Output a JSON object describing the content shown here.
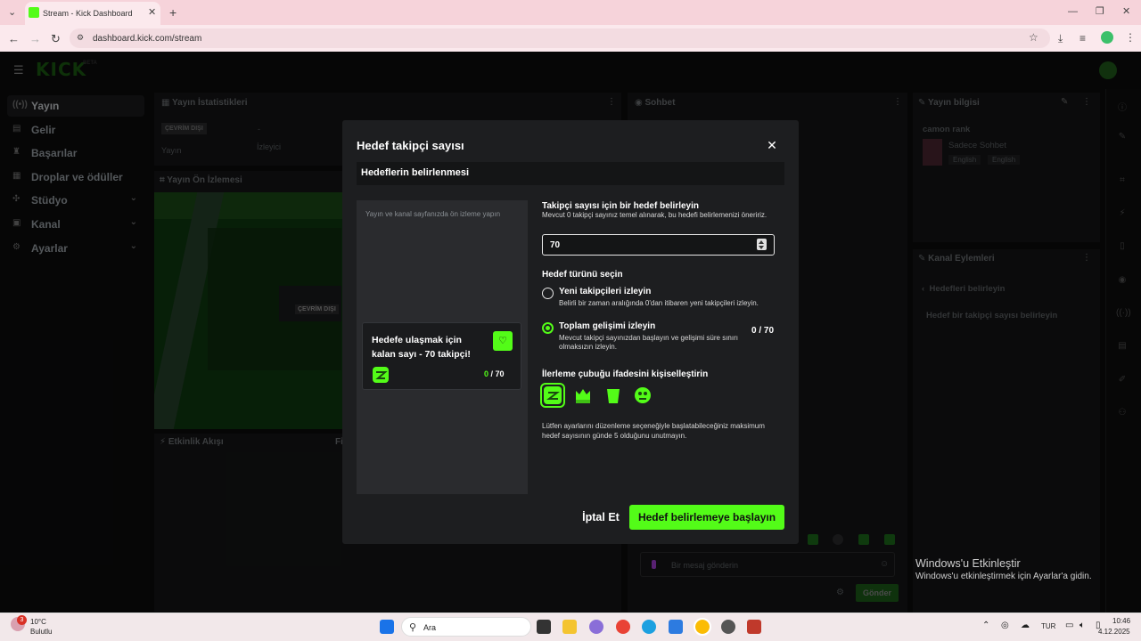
{
  "browser": {
    "tab_title": "Stream - Kick Dashboard",
    "url": "dashboard.kick.com/stream"
  },
  "app": {
    "logo": "KICK",
    "logo_badge": "BETA"
  },
  "sidebar": {
    "items": [
      {
        "label": "Yayın",
        "icon": "broadcast-icon",
        "active": true
      },
      {
        "label": "Gelir",
        "icon": "money-icon"
      },
      {
        "label": "Başarılar",
        "icon": "trophy-icon"
      },
      {
        "label": "Droplar ve ödüller",
        "icon": "gift-icon"
      },
      {
        "label": "Stüdyo",
        "icon": "studio-icon",
        "expandable": true
      },
      {
        "label": "Kanal",
        "icon": "channel-icon",
        "expandable": true
      },
      {
        "label": "Ayarlar",
        "icon": "gear-icon",
        "expandable": true
      }
    ]
  },
  "panels": {
    "stats_title": "Yayın İstatistikleri",
    "offline_badge": "ÇEVRİM DIŞI",
    "stats_dash": "-",
    "stats_col1": "Yayın",
    "stats_col2": "İzleyici",
    "preview_title": "Yayın Ön İzlemesi",
    "preview_offline": "ÇEVRİM DIŞI",
    "activity_title": "Etkinlik Akışı",
    "activity_filter": "Fi",
    "chat_title": "Sohbet",
    "chat_placeholder": "Bir mesaj gönderin",
    "chat_send": "Gönder",
    "info_title": "Yayın bilgisi",
    "info_stream_title": "camon rank",
    "info_category": "Sadece Sohbet",
    "info_tag1": "English",
    "info_tag2": "English",
    "actions_title": "Kanal Eylemleri",
    "actions_back": "Hedefleri belirleyin",
    "actions_item": "Hedef bir takipçi sayısı belirleyin"
  },
  "modal": {
    "title": "Hedef takipçi sayısı",
    "section_title": "Hedeflerin belirlenmesi",
    "preview_hint": "Yayın ve kanal sayfanızda ön izleme yapın",
    "card_title": "Hedefe ulaşmak için kalan sayı - 70 takipçi!",
    "card_count_current": "0",
    "card_count_total": "/ 70",
    "goal_label": "Takipçi sayısı için bir hedef belirleyin",
    "goal_hint": "Mevcut 0 takipçi sayınız temel alınarak, bu hedefi belirlemenizi öneririz.",
    "goal_value": "70",
    "type_label": "Hedef türünü seçin",
    "option1_title": "Yeni takipçileri izleyin",
    "option1_desc": "Belirli bir zaman aralığında 0'dan itibaren yeni takipçileri izleyin.",
    "option2_title": "Toplam gelişimi izleyin",
    "option2_desc": "Mevcut takipçi sayınızdan başlayın ve gelişimi süre sınırı olmaksızın izleyin.",
    "option2_count": "0 / 70",
    "selected_option": 2,
    "emote_label": "İlerleme çubuğu ifadesini kişiselleştirin",
    "emotes": [
      "kick-face-emote",
      "crown-emote",
      "green-blob-emote",
      "dizzy-emote"
    ],
    "note": "Lütfen ayarlarını düzenleme seçeneğiyle başlatabileceğiniz maksimum hedef sayısının günde 5 olduğunu unutmayın.",
    "cancel_label": "İptal Et",
    "start_label": "Hedef belirlemeye başlayın"
  },
  "taskbar": {
    "weather_temp": "10°C",
    "weather_desc": "Bulutlu",
    "notif_count": "3",
    "search_placeholder": "Ara",
    "lang": "TUR",
    "time": "10:46",
    "date": "4.12.2025"
  },
  "watermark": {
    "title": "Windows'u Etkinleştir",
    "subtitle": "Windows'u etkinleştirmek için Ayarlar'a gidin."
  },
  "colors": {
    "accent": "#53fc18",
    "modal_bg": "#1d1e20",
    "page_bg": "#0b0b0c"
  }
}
